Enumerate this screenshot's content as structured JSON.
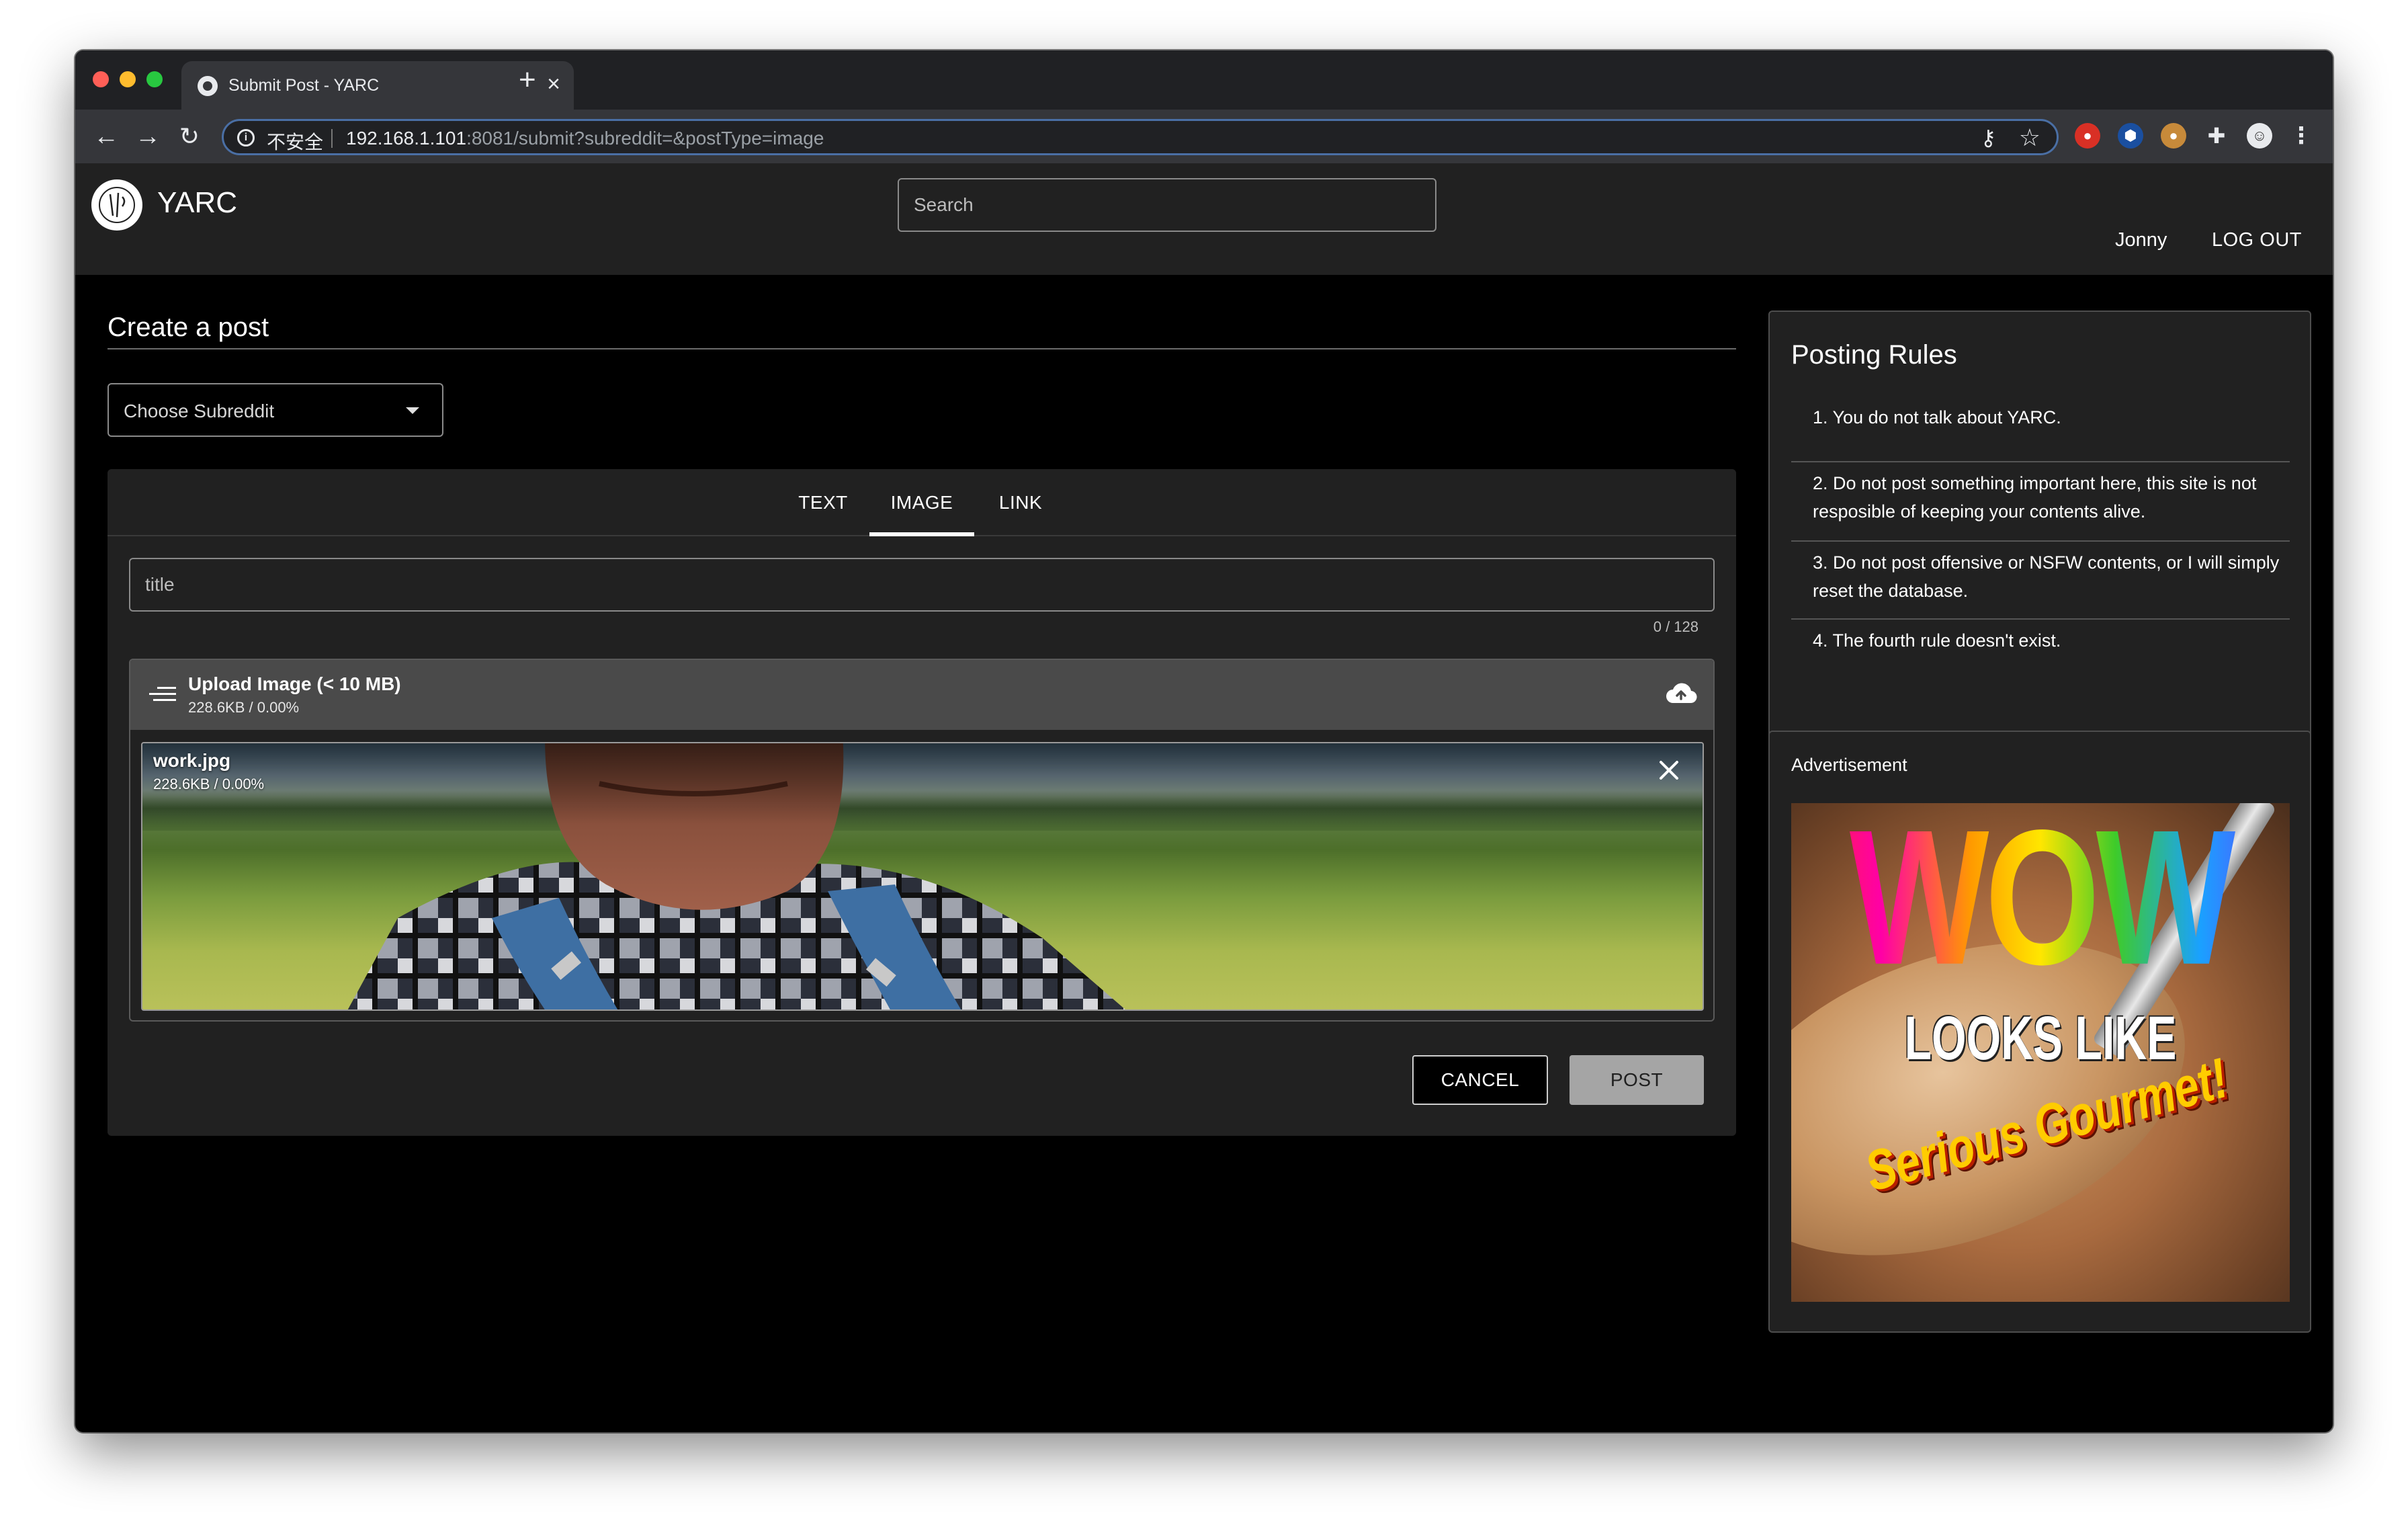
{
  "browser": {
    "tab_title": "Submit Post - YARC",
    "new_tab_icon": "plus-icon",
    "security_label": "不安全",
    "url_host": "192.168.1.101",
    "url_rest": ":8081/submit?subreddit=&postType=image"
  },
  "header": {
    "brand": "YARC",
    "search_placeholder": "Search",
    "username": "Jonny",
    "logout": "LOG OUT"
  },
  "main": {
    "page_title": "Create a post",
    "subreddit_select": "Choose Subreddit",
    "tabs": [
      {
        "label": "TEXT",
        "active": false
      },
      {
        "label": "IMAGE",
        "active": true
      },
      {
        "label": "LINK",
        "active": false
      }
    ],
    "title_placeholder": "title",
    "char_count": "0 / 128",
    "upload": {
      "title": "Upload Image (< 10 MB)",
      "summary": "228.6KB / 0.00%",
      "file_name": "work.jpg",
      "file_summary": "228.6KB / 0.00%",
      "progress_percent": 0
    },
    "cancel_label": "CANCEL",
    "post_label": "POST"
  },
  "sidebar": {
    "rules_title": "Posting Rules",
    "rules": [
      "1. You do not talk about YARC.",
      "2. Do not post something important here, this site is not resposible of keeping your contents alive.",
      "3. Do not post offensive or NSFW contents, or I will simply reset the database.",
      "4. The fourth rule doesn't exist."
    ],
    "ad_title": "Advertisement",
    "ad_text": {
      "line1": "WOW",
      "line2": "LOOKS LIKE",
      "line3": "Serious Gourmet!"
    }
  },
  "colors": {
    "background": "#000000",
    "surface": "#212121",
    "upload_header": "#4a4a4a",
    "post_button": "#a5a5a5",
    "text": "#ffffff"
  }
}
